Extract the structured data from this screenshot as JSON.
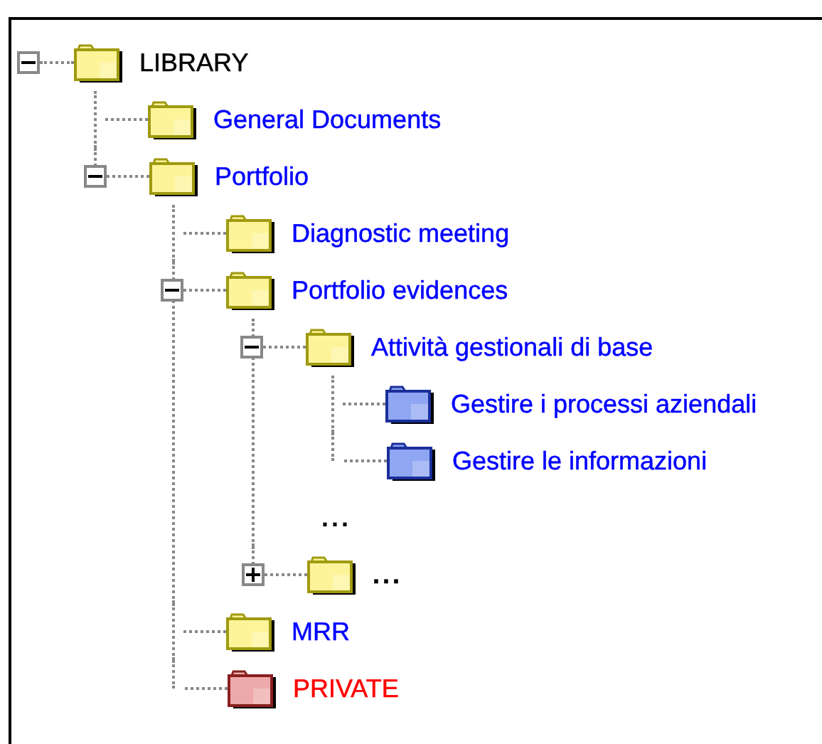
{
  "tree": {
    "label": "LIBRARY",
    "kind": "root",
    "expanded": true,
    "children": [
      {
        "label": "General Documents",
        "kind": "folder"
      },
      {
        "label": "Portfolio",
        "kind": "folder",
        "expanded": true,
        "children": [
          {
            "label": "Diagnostic meeting",
            "kind": "folder"
          },
          {
            "label": "Portfolio evidences",
            "kind": "folder",
            "expanded": true,
            "children": [
              {
                "label": "Attività gestionali di base",
                "kind": "folder",
                "expanded": true,
                "children": [
                  {
                    "label": "Gestire i processi aziendali",
                    "kind": "module"
                  },
                  {
                    "label": "Gestire le informazioni",
                    "kind": "module"
                  },
                  {
                    "label": "...",
                    "kind": "more"
                  }
                ]
              },
              {
                "label": "...",
                "kind": "stub",
                "expanded": false
              }
            ]
          },
          {
            "label": "MRR",
            "kind": "folder"
          },
          {
            "label": "PRIVATE",
            "kind": "private"
          }
        ]
      }
    ]
  }
}
